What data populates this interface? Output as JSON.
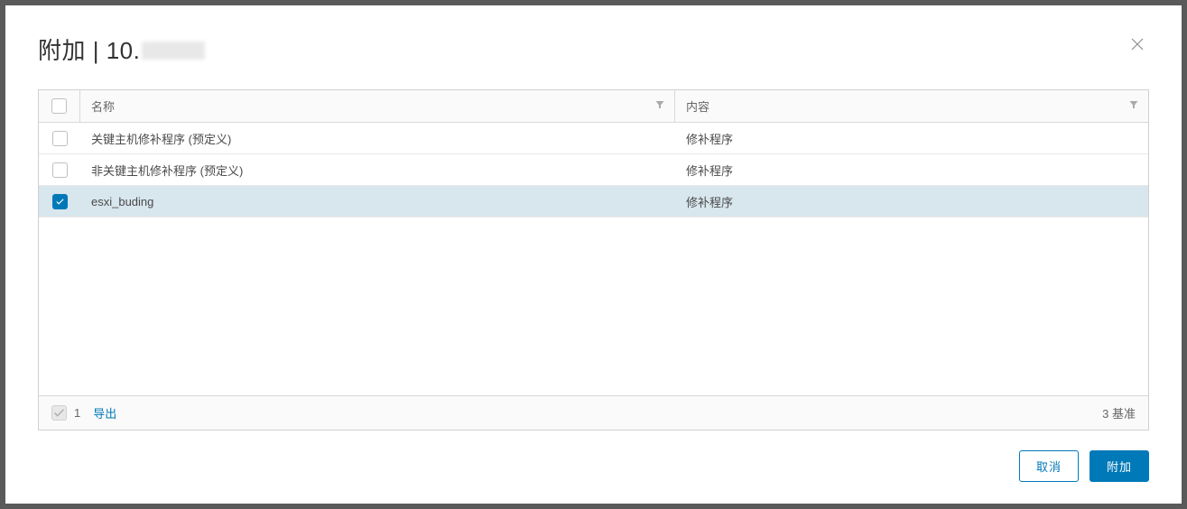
{
  "dialog": {
    "title_prefix": "附加 | 10.",
    "close_aria": "Close"
  },
  "table": {
    "columns": {
      "name": "名称",
      "content": "内容"
    },
    "rows": [
      {
        "name": "关键主机修补程序 (预定义)",
        "content": "修补程序",
        "checked": false
      },
      {
        "name": "非关键主机修补程序 (预定义)",
        "content": "修补程序",
        "checked": false
      },
      {
        "name": "esxi_buding",
        "content": "修补程序",
        "checked": true
      }
    ]
  },
  "footer": {
    "selected_count": "1",
    "export_label": "导出",
    "total_label": "3 基准"
  },
  "actions": {
    "cancel": "取消",
    "attach": "附加"
  }
}
